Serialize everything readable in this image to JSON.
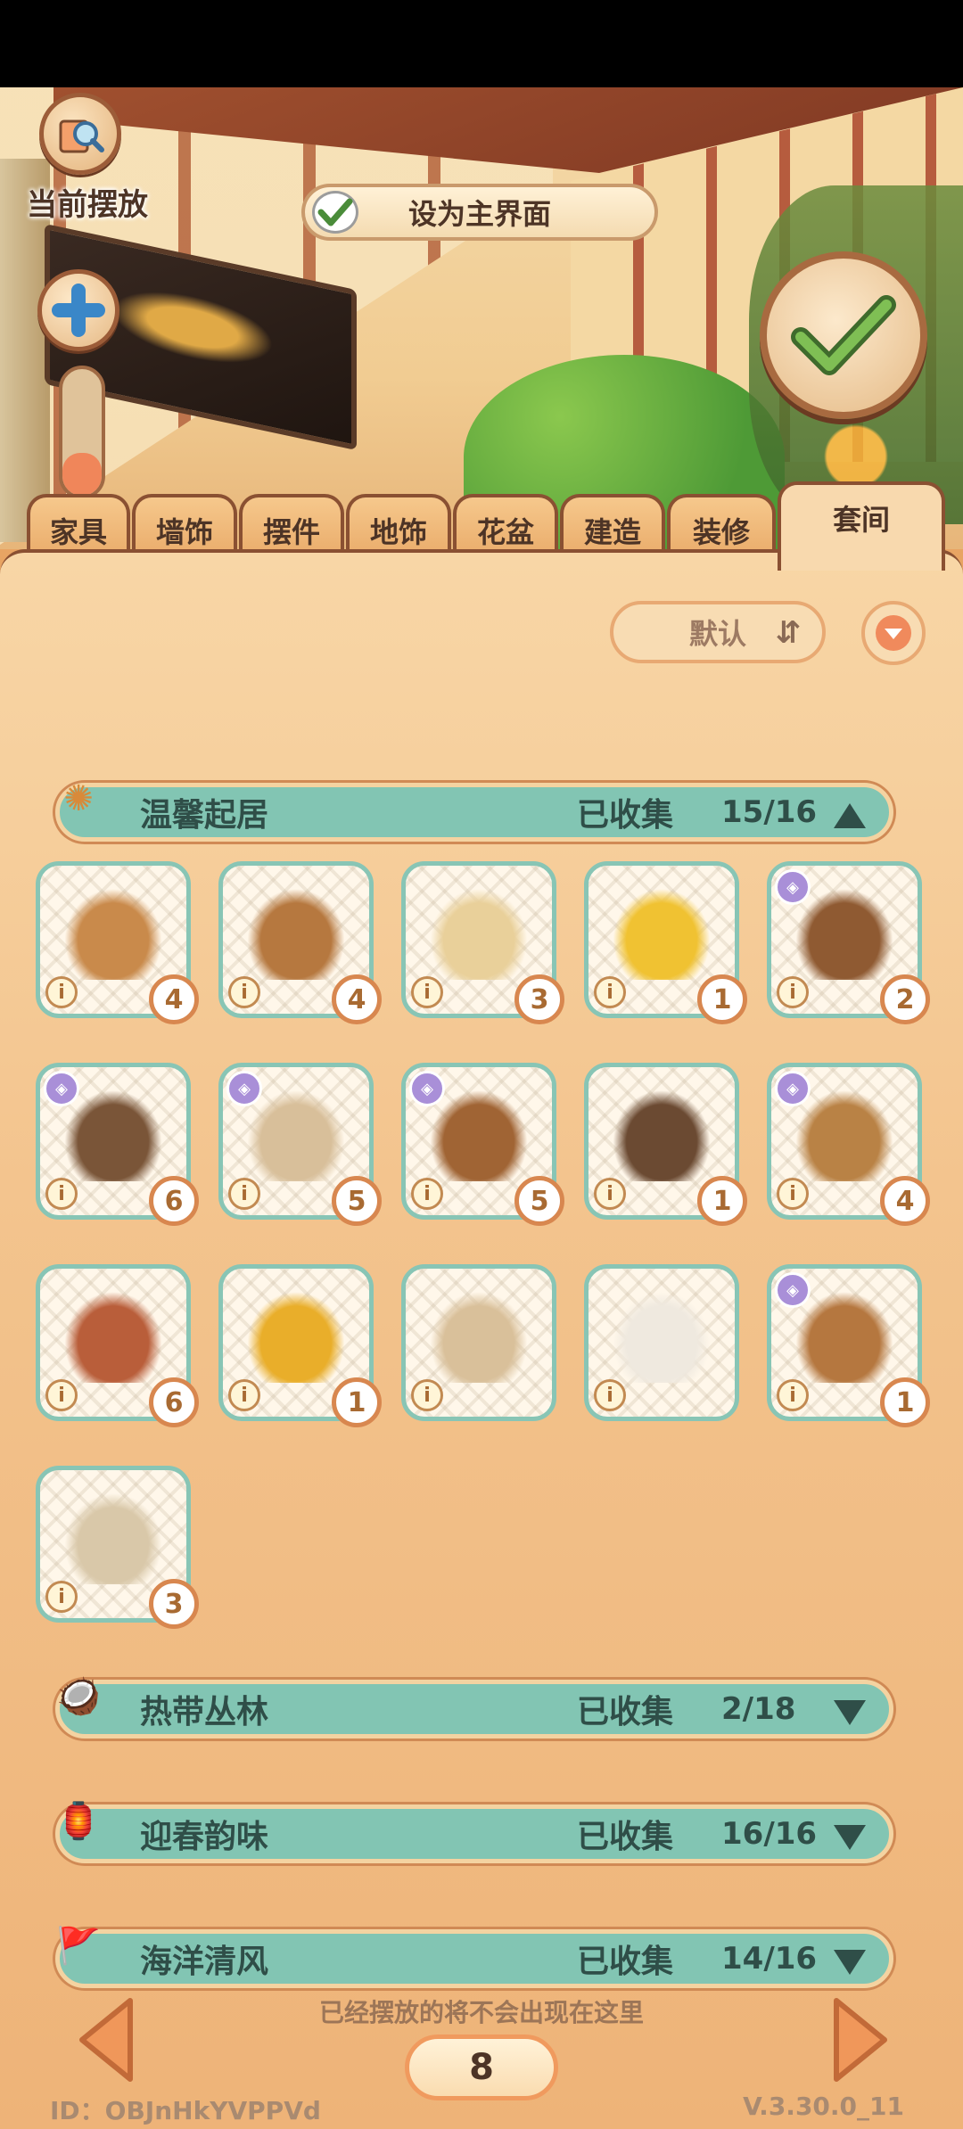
{
  "floating": {
    "current_label": "当前摆放",
    "set_home_label": "设为主界面"
  },
  "tabs": [
    "家具",
    "墙饰",
    "摆件",
    "地饰",
    "花盆",
    "建造",
    "装修",
    "套间"
  ],
  "active_tab": "套间",
  "sort": {
    "label": "默认"
  },
  "categories": [
    {
      "name": "温馨起居",
      "collected_label": "已收集",
      "count": "15/16",
      "expanded": true
    },
    {
      "name": "热带丛林",
      "collected_label": "已收集",
      "count": "2/18",
      "expanded": false
    },
    {
      "name": "迎春韵味",
      "collected_label": "已收集",
      "count": "16/16",
      "expanded": false
    },
    {
      "name": "海洋清风",
      "collected_label": "已收集",
      "count": "14/16",
      "expanded": false
    }
  ],
  "items": [
    {
      "name": "wooden-table",
      "qty": "4",
      "badge": false,
      "color": "#c98a4b"
    },
    {
      "name": "bookshelf",
      "qty": "4",
      "badge": false,
      "color": "#b6783f"
    },
    {
      "name": "round-rug",
      "qty": "3",
      "badge": false,
      "color": "#e9d09a"
    },
    {
      "name": "flower-plant",
      "qty": "1",
      "badge": false,
      "color": "#f0c232"
    },
    {
      "name": "cabinet",
      "qty": "2",
      "badge": true,
      "color": "#8f5a32"
    },
    {
      "name": "standing-lamp",
      "qty": "6",
      "badge": true,
      "color": "#7a5538"
    },
    {
      "name": "table-lamp",
      "qty": "5",
      "badge": true,
      "color": "#d8bf9a"
    },
    {
      "name": "armoire",
      "qty": "5",
      "badge": true,
      "color": "#a06434"
    },
    {
      "name": "hanging-chain",
      "qty": "1",
      "badge": false,
      "color": "#6b4a32"
    },
    {
      "name": "bench",
      "qty": "4",
      "badge": true,
      "color": "#b98245"
    },
    {
      "name": "wall-hanging",
      "qty": "6",
      "badge": false,
      "color": "#b95e3a"
    },
    {
      "name": "sunflower-plant",
      "qty": "1",
      "badge": false,
      "color": "#e9ae2a"
    },
    {
      "name": "square-rug",
      "qty": "",
      "badge": false,
      "color": "#d9c09a"
    },
    {
      "name": "folding-screen",
      "qty": "",
      "badge": false,
      "color": "#efe9df"
    },
    {
      "name": "armchair",
      "qty": "1",
      "badge": true,
      "color": "#b5773f"
    },
    {
      "name": "vase-branch",
      "qty": "3",
      "badge": false,
      "color": "#d9c8a9"
    }
  ],
  "footer": {
    "notice": "已经摆放的将不会出现在这里",
    "page": "8",
    "id_text": "ID：OBJnHkYVPPVd",
    "version": "V.3.30.0_11"
  },
  "colors": {
    "panel": "#f3c48e",
    "category": "#82c5b3",
    "accent": "#f09a5e"
  }
}
